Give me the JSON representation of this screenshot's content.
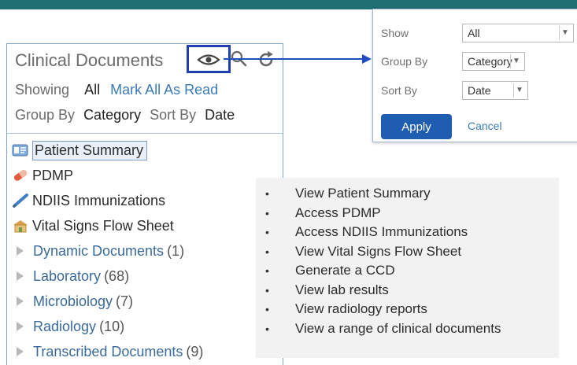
{
  "panel": {
    "title": "Clinical Documents",
    "showing_label": "Showing",
    "showing_value": "All",
    "mark_all_label": "Mark All As Read",
    "group_by_label": "Group By",
    "group_by_value": "Category",
    "sort_by_label": "Sort By",
    "sort_by_value": "Date"
  },
  "documents": [
    {
      "label": "Patient Summary",
      "icon": "patient-summary-icon"
    },
    {
      "label": "PDMP",
      "icon": "pill-icon"
    },
    {
      "label": "NDIIS Immunizations",
      "icon": "syringe-icon"
    },
    {
      "label": "Vital Signs Flow Sheet",
      "icon": "vitals-chart-icon"
    }
  ],
  "folders": [
    {
      "label": "Dynamic Documents",
      "count": "(1)"
    },
    {
      "label": "Laboratory",
      "count": "(68)"
    },
    {
      "label": "Microbiology",
      "count": "(7)"
    },
    {
      "label": "Radiology",
      "count": "(10)"
    },
    {
      "label": "Transcribed Documents",
      "count": "(9)"
    }
  ],
  "popup": {
    "show_label": "Show",
    "show_value": "All",
    "group_by_label": "Group By",
    "group_by_value": "Category",
    "sort_by_label": "Sort By",
    "sort_by_value": "Date",
    "apply_label": "Apply",
    "cancel_label": "Cancel"
  },
  "features": {
    "bullet": "•",
    "items": [
      "View Patient Summary",
      "Access  PDMP",
      "Access NDIIS Immunizations",
      "View Vital Signs Flow Sheet",
      "Generate a CCD",
      "View lab results",
      "View radiology reports",
      "View a range of clinical documents"
    ]
  },
  "colors": {
    "topbar": "#1f6f73",
    "highlight_box": "#1f3fae",
    "apply_button": "#1e5db0",
    "link": "#3a7ab8"
  }
}
